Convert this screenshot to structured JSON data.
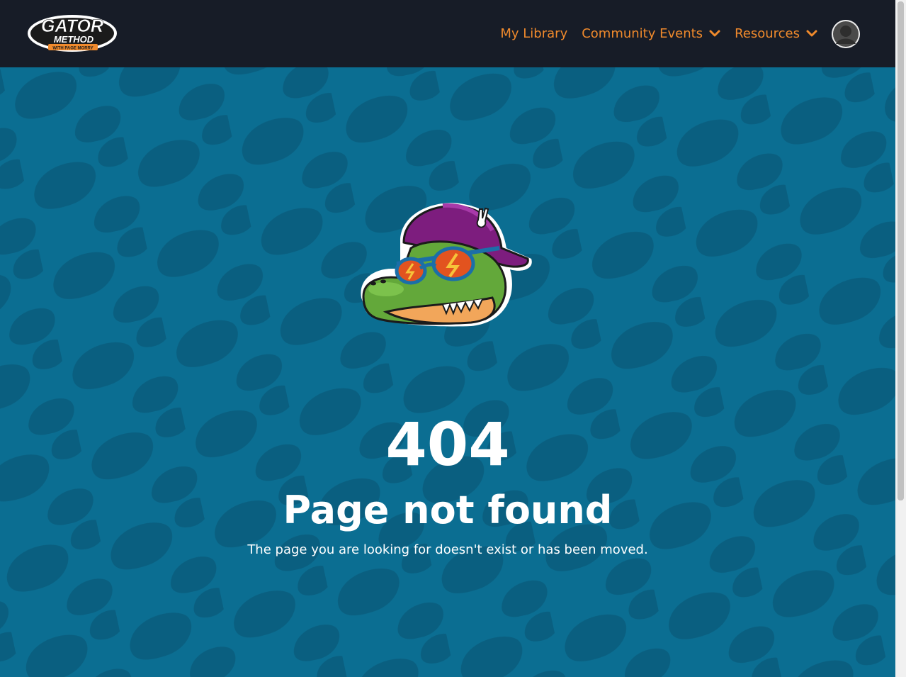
{
  "header": {
    "logo_text": "GATOR",
    "logo_sub": "METHOD",
    "logo_tag": "WITH PAGE MORRY",
    "nav": [
      {
        "label": "My Library",
        "dropdown": false
      },
      {
        "label": "Community Events",
        "dropdown": true
      },
      {
        "label": "Resources",
        "dropdown": true
      }
    ],
    "accent_color": "#f08a2c",
    "bg_color": "#171c27"
  },
  "error": {
    "code": "404",
    "title": "Page not found",
    "message": "The page you are looking for doesn't exist or has been moved."
  },
  "colors": {
    "background": "#0b6e92",
    "scale_pattern": "#0a5f80",
    "text": "#ffffff"
  },
  "icons": {
    "chevron": "chevron-down-icon",
    "avatar": "user-avatar-icon",
    "mascot": "gator-mascot-illustration"
  }
}
